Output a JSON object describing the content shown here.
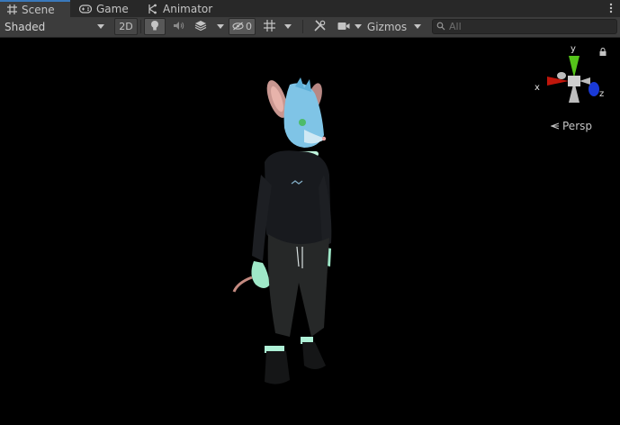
{
  "tabs": [
    {
      "label": "Scene",
      "icon": "grid-icon",
      "active": true
    },
    {
      "label": "Game",
      "icon": "gamepad-icon",
      "active": false
    },
    {
      "label": "Animator",
      "icon": "animator-icon",
      "active": false
    }
  ],
  "toolbar": {
    "shading_mode": "Shaded",
    "mode_2d_label": "2D",
    "hidden_count": "0",
    "gizmos_label": "Gizmos"
  },
  "search": {
    "placeholder": "All"
  },
  "viewport": {
    "projection_label": "Persp",
    "axes": {
      "x": "x",
      "y": "y",
      "z": "z"
    }
  },
  "colors": {
    "accent": "#3a79bb",
    "axis_x": "#c0160b",
    "axis_y": "#55c41a",
    "axis_z": "#1a3ad6",
    "background": "#000000",
    "toolbar": "#3c3c3c"
  }
}
